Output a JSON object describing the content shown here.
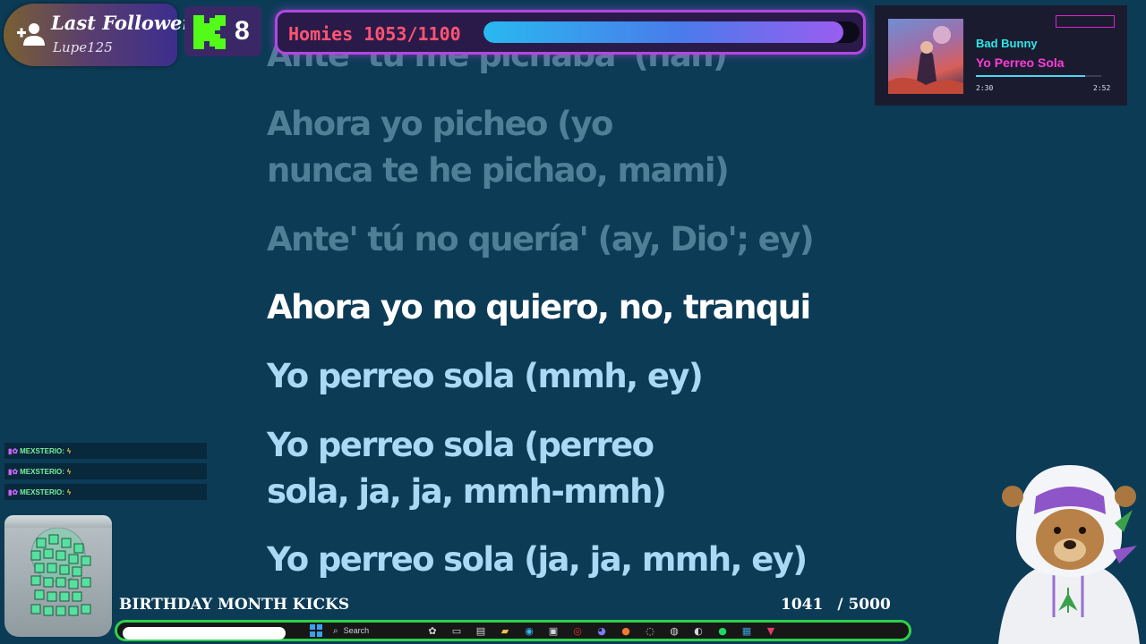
{
  "follower": {
    "title": "Last Follower",
    "name": "Lupe125"
  },
  "kick_counter": {
    "value": "8"
  },
  "goal": {
    "label": "Homies 1053/1100",
    "current": 1053,
    "target": 1100,
    "progress": 0.957
  },
  "now_playing": {
    "artist": "Bad Bunny",
    "song": "Yo Perreo Sola",
    "time_current": "2:30",
    "time_total": "2:52",
    "progress": 0.87
  },
  "lyrics": [
    {
      "text": "Ante' tú me pichaba' (nah)",
      "state": "past"
    },
    {
      "text": "Ahora yo picheo (yo\nnunca te he pichao, mami)",
      "state": "past"
    },
    {
      "text": "Ante' tú no quería' (ay, Dio'; ey)",
      "state": "past"
    },
    {
      "text": "Ahora yo no quiero, no, tranqui",
      "state": "current"
    },
    {
      "text": "Yo perreo sola (mmh, ey)",
      "state": "next"
    },
    {
      "text": "Yo perreo sola (perreo\nsola, ja, ja, mmh-mmh)",
      "state": "next"
    },
    {
      "text": "Yo perreo sola (ja, ja, mmh, ey)",
      "state": "next"
    }
  ],
  "chat": [
    {
      "user": "MEXSTERIO:"
    },
    {
      "user": "MEXSTERIO:"
    },
    {
      "user": "MEXSTERIO:"
    }
  ],
  "birthday": {
    "label": "BIRTHDAY MONTH KICKS",
    "current": "1041",
    "goal": "/ 5000",
    "progress": 0.2082
  },
  "taskbar": {
    "search_label": "Search"
  },
  "colors": {
    "background": "#0c3b56",
    "lyric_past": "#4f7f97",
    "lyric_current": "#ffffff",
    "lyric_next": "#a9d9f4",
    "kick_green": "#53fc18",
    "goal_border": "#b148e0",
    "goal_label": "#ff5472"
  }
}
